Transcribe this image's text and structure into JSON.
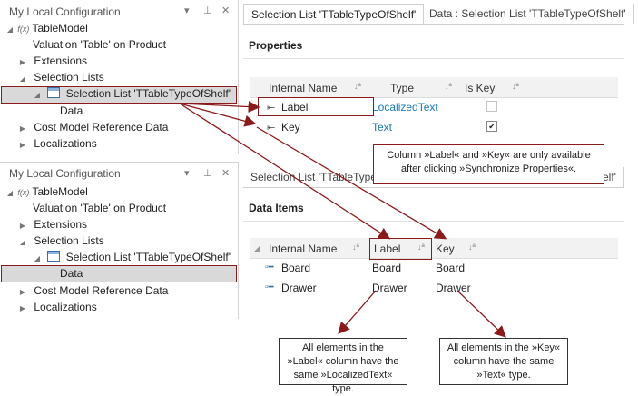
{
  "top_panel": {
    "title": "My Local Configuration",
    "fx": "f(x)",
    "tree": [
      "TableModel",
      "Valuation 'Table' on Product",
      "Extensions",
      "Selection Lists",
      "Selection List 'TTableTypeOfShelf'",
      "Data",
      "Cost Model Reference Data",
      "Localizations"
    ]
  },
  "bottom_panel": {
    "title": "My Local Configuration",
    "fx": "f(x)",
    "tree": [
      "TableModel",
      "Valuation 'Table' on Product",
      "Extensions",
      "Selection Lists",
      "Selection List 'TTableTypeOfShelf'",
      "Data",
      "Cost Model Reference Data",
      "Localizations"
    ]
  },
  "top_editor": {
    "tabs": [
      "Selection List 'TTableTypeOfShelf'",
      "Data : Selection List 'TTableTypeOfShelf'"
    ],
    "section": "Properties",
    "columns": [
      "Internal Name",
      "Type",
      "Is Key"
    ],
    "rows": [
      {
        "name": "Label",
        "type": "LocalizedText",
        "is_key": false
      },
      {
        "name": "Key",
        "type": "Text",
        "is_key": true
      }
    ]
  },
  "bottom_editor": {
    "tabs": [
      "Selection List 'TTableTypeOf",
      "elf'"
    ],
    "section": "Data Items",
    "columns": [
      "Internal Name",
      "Label",
      "Key"
    ],
    "rows": [
      {
        "name": "Board",
        "label": "Board",
        "key": "Board"
      },
      {
        "name": "Drawer",
        "label": "Drawer",
        "key": "Drawer"
      }
    ]
  },
  "callouts": {
    "sync": "Column »Label« and »Key« are only available after clicking »Synchronize Properties«.",
    "label_type": "All elements in the »Label« column have the same »LocalizedText« type.",
    "key_type": "All elements in the »Key« column have the same »Text« type."
  },
  "icons": {
    "dropdown": "▾",
    "pin": "⊥",
    "close": "✕",
    "check": "✔"
  },
  "colors": {
    "accent_red": "#8b1a1a",
    "link_blue": "#1a7ab8",
    "selection_gray": "#d9d9d9"
  }
}
